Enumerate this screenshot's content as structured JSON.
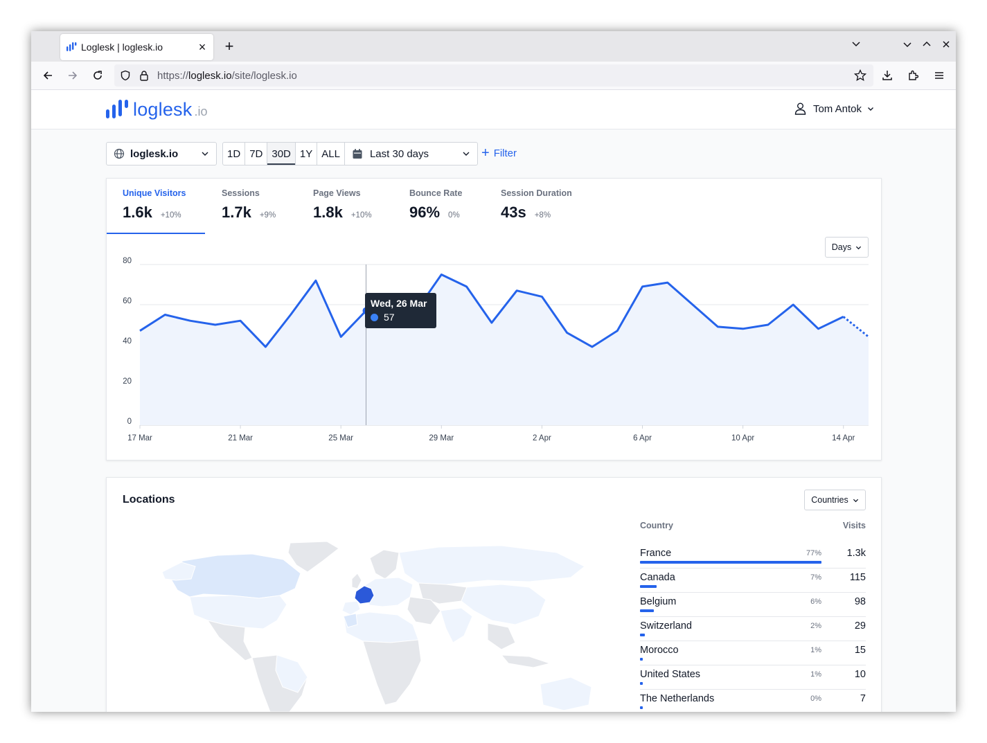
{
  "browser": {
    "tab_title": "Loglesk | loglesk.io",
    "url_prefix": "https://",
    "url_host": "loglesk.io",
    "url_path": "/site/loglesk.io"
  },
  "app": {
    "logo_word": "loglesk",
    "logo_tld": ".io",
    "user_name": "Tom Antok"
  },
  "controls": {
    "site": "loglesk.io",
    "periods": [
      "1D",
      "7D",
      "30D",
      "1Y",
      "ALL"
    ],
    "active_period": "30D",
    "range": "Last 30 days",
    "filter_label": "Filter"
  },
  "metrics": [
    {
      "label": "Unique Visitors",
      "value": "1.6k",
      "change": "+10%"
    },
    {
      "label": "Sessions",
      "value": "1.7k",
      "change": "+9%"
    },
    {
      "label": "Page Views",
      "value": "1.8k",
      "change": "+10%"
    },
    {
      "label": "Bounce Rate",
      "value": "96%",
      "change": "0%"
    },
    {
      "label": "Session Duration",
      "value": "43s",
      "change": "+8%"
    }
  ],
  "granularity": "Days",
  "tooltip": {
    "date": "Wed, 26 Mar",
    "value": "57"
  },
  "chart_data": {
    "type": "area",
    "series": [
      {
        "name": "Unique Visitors",
        "values": [
          47,
          55,
          52,
          50,
          52,
          39,
          55,
          72,
          44,
          57,
          55,
          57,
          75,
          69,
          51,
          67,
          64,
          46,
          39,
          47,
          69,
          71,
          60,
          49,
          48,
          50,
          60,
          48,
          54,
          44
        ]
      }
    ],
    "x": [
      "17 Mar",
      "18 Mar",
      "19 Mar",
      "20 Mar",
      "21 Mar",
      "22 Mar",
      "23 Mar",
      "24 Mar",
      "25 Mar",
      "26 Mar",
      "27 Mar",
      "28 Mar",
      "29 Mar",
      "30 Mar",
      "31 Mar",
      "1 Apr",
      "2 Apr",
      "3 Apr",
      "4 Apr",
      "5 Apr",
      "6 Apr",
      "7 Apr",
      "8 Apr",
      "9 Apr",
      "10 Apr",
      "11 Apr",
      "12 Apr",
      "13 Apr",
      "14 Apr",
      "15 Apr"
    ],
    "xticks": [
      "17 Mar",
      "21 Mar",
      "25 Mar",
      "29 Mar",
      "2 Apr",
      "6 Apr",
      "10 Apr",
      "14 Apr"
    ],
    "yticks": [
      0,
      20,
      40,
      60,
      80
    ],
    "ylim": [
      0,
      80
    ],
    "grid": true,
    "color": "#2563eb",
    "last_point_partial": true
  },
  "locations": {
    "title": "Locations",
    "view": "Countries",
    "col_country": "Country",
    "col_visits": "Visits",
    "rows": [
      {
        "country": "France",
        "pct": "77%",
        "visits": "1.3k",
        "share": 0.77
      },
      {
        "country": "Canada",
        "pct": "7%",
        "visits": "115",
        "share": 0.07
      },
      {
        "country": "Belgium",
        "pct": "6%",
        "visits": "98",
        "share": 0.06
      },
      {
        "country": "Switzerland",
        "pct": "2%",
        "visits": "29",
        "share": 0.02
      },
      {
        "country": "Morocco",
        "pct": "1%",
        "visits": "15",
        "share": 0.01
      },
      {
        "country": "United States",
        "pct": "1%",
        "visits": "10",
        "share": 0.01
      },
      {
        "country": "The Netherlands",
        "pct": "0%",
        "visits": "7",
        "share": 0.005
      }
    ]
  }
}
